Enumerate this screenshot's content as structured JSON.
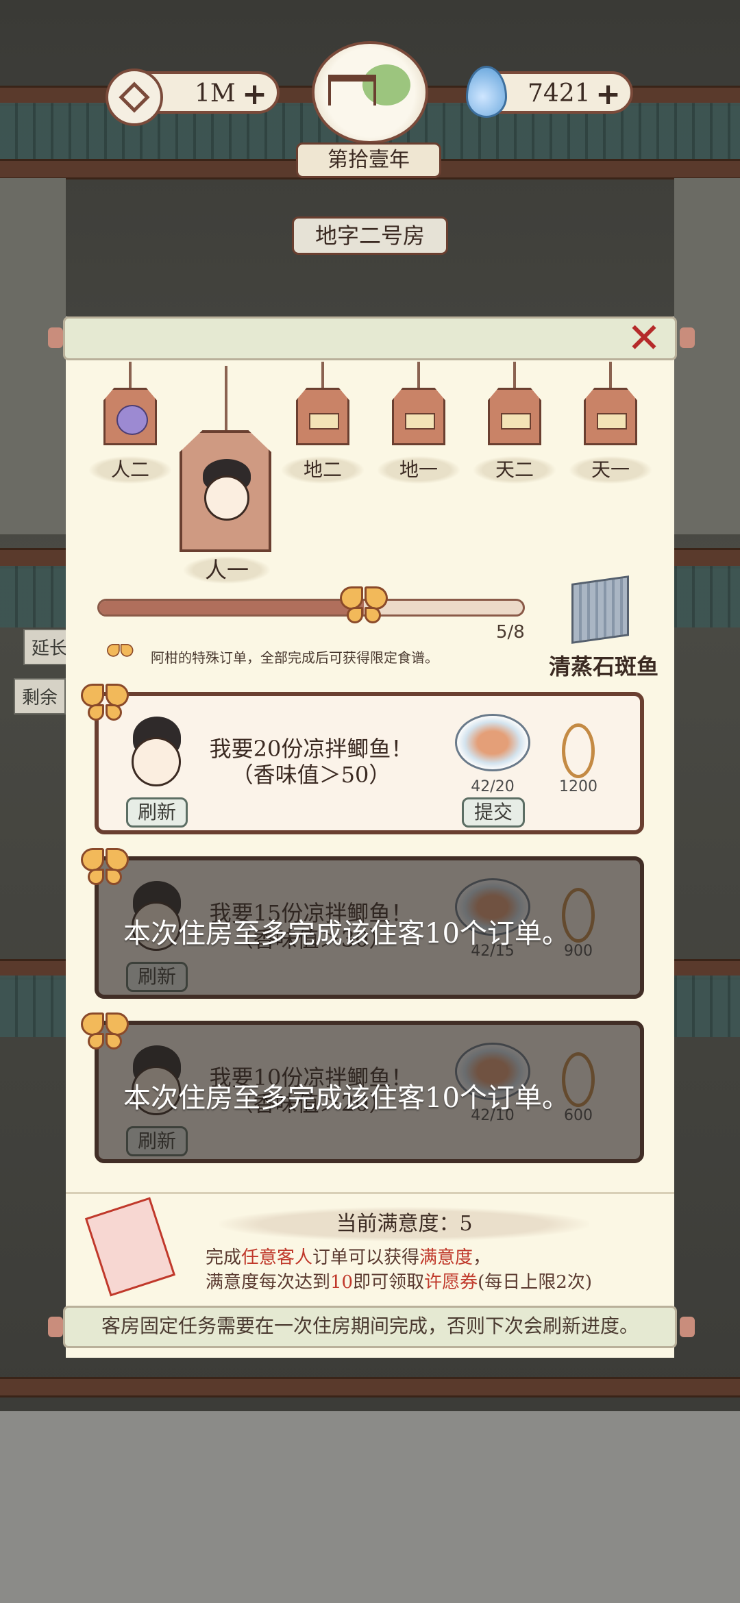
{
  "header": {
    "coins": "1M",
    "coins_plus": "+",
    "gems": "7421",
    "gems_plus": "+",
    "year_badge": "第拾壹年",
    "room_badge": "地字二号房"
  },
  "side": {
    "tag_a": "延长",
    "tag_b": "剩余"
  },
  "tags": [
    {
      "label": "人二",
      "icon": "bun-icon"
    },
    {
      "label": "人一",
      "icon": "guest-avatar-icon"
    },
    {
      "label": "地二",
      "icon": "plate-icon"
    },
    {
      "label": "地一",
      "icon": "plate-icon"
    },
    {
      "label": "天二",
      "icon": "plate-icon"
    },
    {
      "label": "天一",
      "icon": "plate-icon"
    }
  ],
  "progress": {
    "value": 5,
    "max": 8,
    "text": "5/8",
    "note": "阿柑的特殊订单，全部完成后可获得限定食谱。",
    "recipe_name": "清蒸石斑鱼"
  },
  "orders": [
    {
      "request_line1": "我要20份凉拌鲫鱼！",
      "request_line2": "（香味值＞50）",
      "count": "42/20",
      "reward": "1200",
      "refresh": "刷新",
      "submit": "提交",
      "locked": false
    },
    {
      "request_line1": "我要15份凉拌鲫鱼！",
      "request_line2": "（香味值＞30）",
      "count": "42/15",
      "reward": "900",
      "refresh": "刷新",
      "locked": true,
      "lock_message": "本次住房至多完成该住客10个订单。"
    },
    {
      "request_line1": "我要10份凉拌鲫鱼！",
      "request_line2": "（香味值＞20）",
      "count": "42/10",
      "reward": "600",
      "refresh": "刷新",
      "locked": true,
      "lock_message": "本次住房至多完成该住客10个订单。"
    }
  ],
  "satisfaction": {
    "title": "当前满意度：5",
    "line1_a": "完成",
    "line1_red1": "任意客人",
    "line1_b": "订单可以获得",
    "line1_red2": "满意度",
    "line1_c": "，",
    "line2_a": "满意度每次达到",
    "line2_red1": "10",
    "line2_b": "即可领取",
    "line2_red2": "许愿券",
    "line2_c": "(每日上限2次)"
  },
  "footer_note": "客房固定任务需要在一次住房期间完成，否则下次会刷新进度。",
  "colors": {
    "accent_red": "#c0392b",
    "wood_brown": "#6a3f30",
    "paper": "#fbf7e4",
    "progress_fill": "#b06f5c"
  }
}
